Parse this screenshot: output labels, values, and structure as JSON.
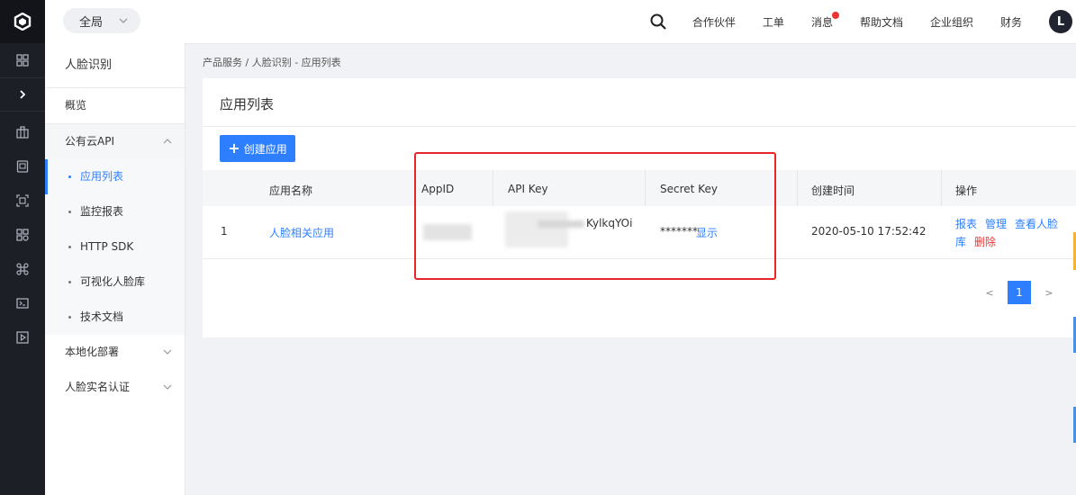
{
  "header": {
    "scope_label": "全局",
    "nav": [
      "合作伙伴",
      "工单",
      "消息",
      "帮助文档",
      "企业组织",
      "财务"
    ],
    "avatar_letter": "L"
  },
  "sidebar": {
    "title": "人脸识别",
    "overview": "概览",
    "groups": {
      "public_api": "公有云API",
      "local_deploy": "本地化部署",
      "realname": "人脸实名认证"
    },
    "sub_items": [
      "应用列表",
      "监控报表",
      "HTTP SDK",
      "可视化人脸库",
      "技术文档"
    ]
  },
  "breadcrumb": "产品服务 / 人脸识别 - 应用列表",
  "page": {
    "title": "应用列表",
    "create_button": "创建应用"
  },
  "table": {
    "headers": {
      "name": "应用名称",
      "appid": "AppID",
      "apikey": "API Key",
      "secretkey": "Secret Key",
      "created": "创建时间",
      "actions": "操作"
    },
    "row": {
      "index": "1",
      "name": "人脸相关应用",
      "apikey_suffix": "KylkqYOi",
      "secret_masked": "*******",
      "show_label": "显示",
      "created": "2020-05-10 17:52:42",
      "actions": {
        "report": "报表",
        "manage": "管理",
        "view_face_db_1": "查看人脸",
        "view_face_db_2": "库",
        "delete": "删除"
      }
    }
  },
  "pagination": {
    "prev": "<",
    "current": "1",
    "next": ">"
  },
  "colors": {
    "accent": "#2d7fff",
    "highlight_box": "#e8262a",
    "rail": "#1c1f26"
  }
}
